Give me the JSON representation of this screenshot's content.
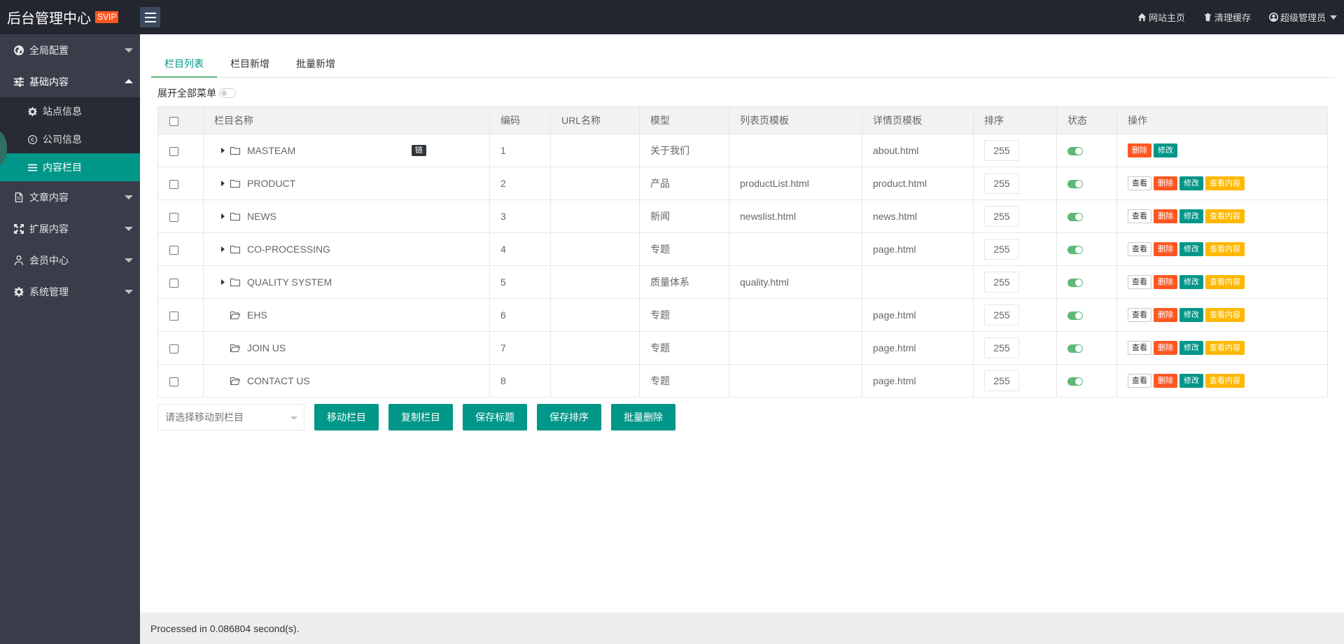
{
  "header": {
    "logo_text": "后台管理中心",
    "logo_badge": "SVIP",
    "links": {
      "home": "网站主页",
      "clear_cache": "清理缓存",
      "user": "超级管理员"
    }
  },
  "sidebar": {
    "items": [
      {
        "label": "全局配置",
        "icon": "globe-icon"
      },
      {
        "label": "基础内容",
        "icon": "sliders-icon"
      },
      {
        "label": "文章内容",
        "icon": "file-icon"
      },
      {
        "label": "扩展内容",
        "icon": "expand-icon"
      },
      {
        "label": "会员中心",
        "icon": "user-icon"
      },
      {
        "label": "系统管理",
        "icon": "gear-icon"
      }
    ],
    "sub_items": [
      {
        "label": "站点信息",
        "icon": "gear-icon"
      },
      {
        "label": "公司信息",
        "icon": "copyright-icon"
      },
      {
        "label": "内容栏目",
        "icon": "list-icon"
      }
    ]
  },
  "tabs": [
    "栏目列表",
    "栏目新增",
    "批量新增"
  ],
  "expand_label": "展开全部菜单",
  "table": {
    "headers": [
      "栏目名称",
      "编码",
      "URL名称",
      "模型",
      "列表页模板",
      "详情页模板",
      "排序",
      "状态",
      "操作"
    ],
    "link_badge": "链",
    "btn_labels": {
      "view": "查看",
      "del": "删除",
      "edit": "修改",
      "content": "查看内容"
    },
    "rows": [
      {
        "name": "MASTEAM",
        "code": "1",
        "url": "",
        "model": "关于我们",
        "list_tpl": "",
        "detail_tpl": "about.html",
        "sort": "255",
        "status": true
      },
      {
        "name": "PRODUCT",
        "code": "2",
        "url": "",
        "model": "产品",
        "list_tpl": "productList.html",
        "detail_tpl": "product.html",
        "sort": "255",
        "status": true
      },
      {
        "name": "NEWS",
        "code": "3",
        "url": "",
        "model": "新闻",
        "list_tpl": "newslist.html",
        "detail_tpl": "news.html",
        "sort": "255",
        "status": true
      },
      {
        "name": "CO-PROCESSING",
        "code": "4",
        "url": "",
        "model": "专题",
        "list_tpl": "",
        "detail_tpl": "page.html",
        "sort": "255",
        "status": true
      },
      {
        "name": "QUALITY SYSTEM",
        "code": "5",
        "url": "",
        "model": "质量体系",
        "list_tpl": "quality.html",
        "detail_tpl": "",
        "sort": "255",
        "status": true
      },
      {
        "name": "EHS",
        "code": "6",
        "url": "",
        "model": "专题",
        "list_tpl": "",
        "detail_tpl": "page.html",
        "sort": "255",
        "status": true
      },
      {
        "name": "JOIN US",
        "code": "7",
        "url": "",
        "model": "专题",
        "list_tpl": "",
        "detail_tpl": "page.html",
        "sort": "255",
        "status": true
      },
      {
        "name": "CONTACT US",
        "code": "8",
        "url": "",
        "model": "专题",
        "list_tpl": "",
        "detail_tpl": "page.html",
        "sort": "255",
        "status": true
      }
    ]
  },
  "bottom": {
    "select_placeholder": "请选择移动到栏目",
    "buttons": [
      "移动栏目",
      "复制栏目",
      "保存标题",
      "保存排序",
      "批量删除"
    ]
  },
  "footer": "Processed in 0.086804 second(s).",
  "colors": {
    "accent": "#009688",
    "danger": "#ff5722",
    "warn": "#ffb800",
    "sidebar": "#393d49",
    "header": "#23262e"
  }
}
